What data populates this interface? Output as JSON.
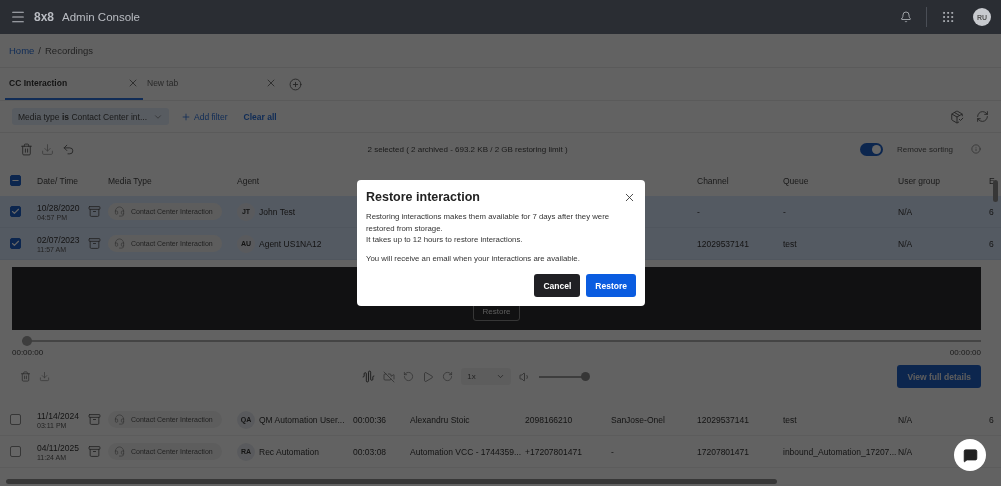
{
  "header": {
    "logo": "8x8",
    "title": "Admin Console",
    "avatar": "RU"
  },
  "breadcrumb": {
    "home": "Home",
    "separator": "/",
    "current": "Recordings"
  },
  "tabs": [
    {
      "label": "CC Interaction",
      "selected": true
    },
    {
      "label": "New tab",
      "selected": false
    }
  ],
  "filters": {
    "chip": "Media type **is** Contact Center int...",
    "add": "Add filter",
    "clear": "Clear all"
  },
  "toolbar": {
    "selection": "2 selected ( 2 archived - 693.2 KB / 2 GB restoring limit )",
    "sort_toggle": {
      "label": "Remove sorting",
      "on": true
    }
  },
  "table": {
    "select_all": {
      "checked": true,
      "partial": true
    },
    "columns": [
      "Date/ Time",
      "Media Type",
      "Agent",
      "Channel",
      "Queue",
      "User group",
      "E"
    ],
    "rows_top": [
      {
        "checked": true,
        "date": "10/28/2020",
        "time": "04:57 PM",
        "media": "Contact Center Interaction",
        "initials": "JT",
        "agent": "John Test",
        "channel": "-",
        "queue": "-",
        "user_group": "N/A",
        "column_11": "6"
      },
      {
        "checked": true,
        "date": "02/07/2023",
        "time": "11:57 AM",
        "media": "Contact Center Interaction",
        "initials": "AU",
        "agent": "Agent US1NA12",
        "channel": "12029537141",
        "queue": "test",
        "user_group": "N/A",
        "column_11": "6"
      }
    ],
    "rows_bottom": [
      {
        "checked": false,
        "date": "11/14/2024",
        "time": "03:11 PM",
        "media": "Contact Center Interaction",
        "initials": "QA",
        "agent": "QM Automation User...",
        "duration": "00:00:36",
        "customer": "Alexandru Stoic",
        "phone": "2098166210",
        "site": "SanJose-Onel",
        "channel": "12029537141",
        "queue": "test",
        "user_group": "N/A",
        "column_11": "6"
      },
      {
        "checked": false,
        "date": "04/11/2025",
        "time": "11:24 AM",
        "media": "Contact Center Interaction",
        "initials": "RA",
        "agent": "Rec Automation",
        "duration": "00:03:08",
        "customer": "Automation VCC - 1744359...",
        "phone": "+17207801471",
        "site": "-",
        "channel": "17207801471",
        "queue": "inbound_Automation_17207...",
        "user_group": "N/A"
      }
    ]
  },
  "player": {
    "overlay_button": "Restore",
    "start": "00:00:00",
    "end": "00:00:00",
    "speed": "1x",
    "progress": {
      "level": 0
    },
    "volume": {
      "level": 1
    },
    "details_button": "View full details"
  },
  "modal": {
    "title": "Restore interaction",
    "paragraphs": [
      [
        "Restoring interactions makes them available for 7 days after they were restored from storage.",
        "It takes up to 12 hours to restore interactions."
      ],
      [
        "You will receive an email when your interactions are available."
      ]
    ],
    "buttons": [
      {
        "label": "Cancel",
        "kind": "secondary"
      },
      {
        "label": "Restore",
        "kind": "primary"
      }
    ]
  }
}
